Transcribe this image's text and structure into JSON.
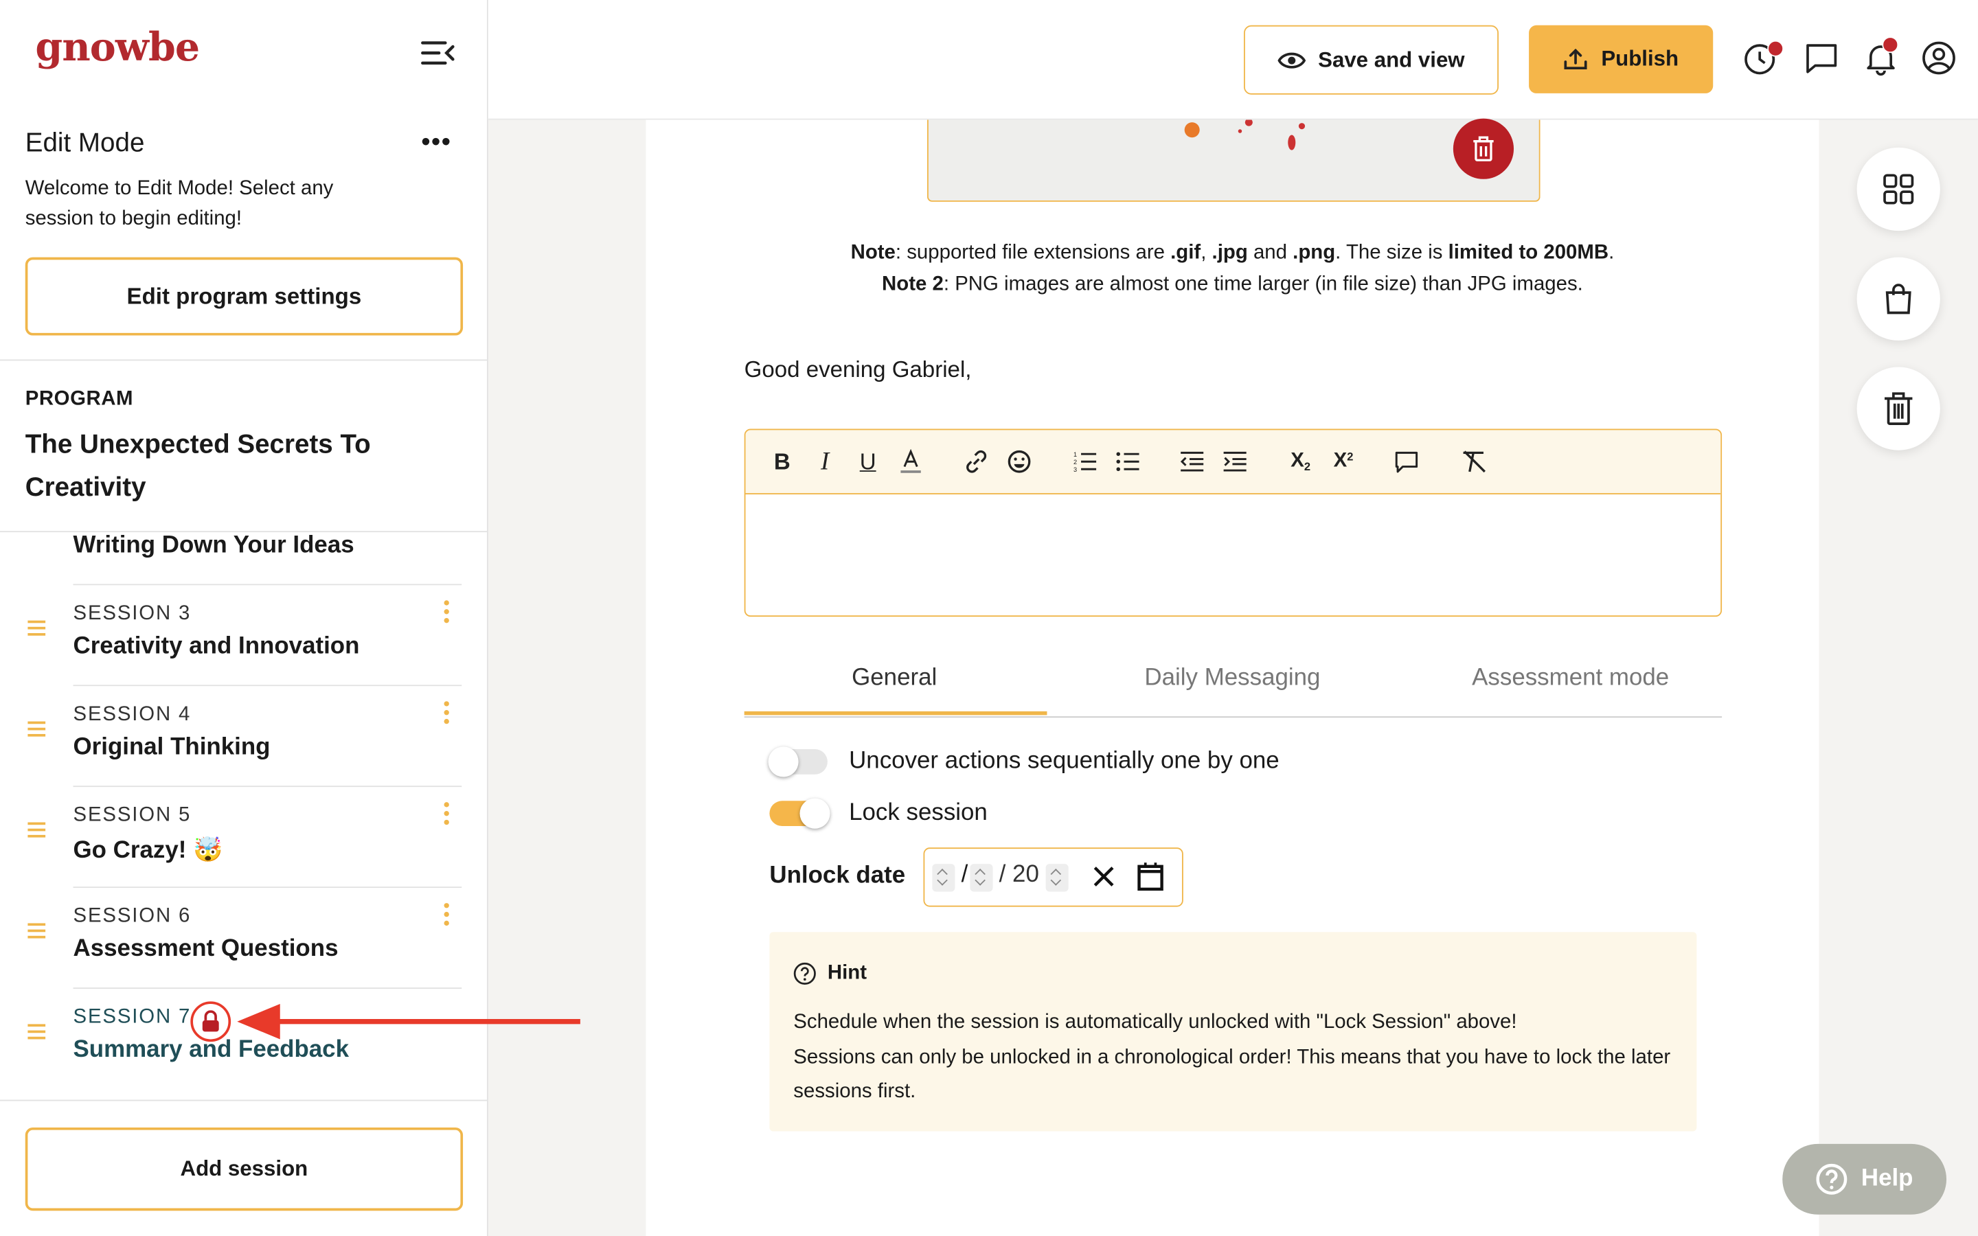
{
  "brand": {
    "logo": "gnowbe",
    "accent": "#f0b64a",
    "primary_button": "#f5b64a",
    "danger": "#b81f25",
    "annotation": "#e83a2a"
  },
  "sidebar": {
    "title": "Edit Mode",
    "welcome": "Welcome to Edit Mode! Select any session to begin editing!",
    "edit_settings_label": "Edit program settings",
    "program_label": "PROGRAM",
    "program_title": "The Unexpected Secrets To Creativity",
    "partial_session_name": "Writing Down Your Ideas",
    "sessions": [
      {
        "number": "SESSION 3",
        "name": "Creativity and Innovation"
      },
      {
        "number": "SESSION 4",
        "name": "Original Thinking"
      },
      {
        "number": "SESSION 5",
        "name": "Go Crazy! 🤯"
      },
      {
        "number": "SESSION 6",
        "name": "Assessment Questions"
      },
      {
        "number": "SESSION 7",
        "name": "Summary and Feedback",
        "selected_color": "#1f4e57",
        "locked": true
      }
    ],
    "add_session_label": "Add session"
  },
  "topbar": {
    "save_view_label": "Save and view",
    "publish_label": "Publish",
    "icons": [
      "history-icon",
      "chat-icon",
      "bell-icon",
      "profile-icon"
    ]
  },
  "content": {
    "note1_label": "Note",
    "note1_text1": ": supported file extensions are ",
    "ext_gif": ".gif",
    "comma": ", ",
    "ext_jpg": ".jpg",
    "and": " and ",
    "ext_png": ".png",
    "note1_text2": ". The size is ",
    "size_limit": "limited to 200MB",
    "period": ".",
    "note2_label": "Note 2",
    "note2_text": ": PNG images are almost one time larger (in file size) than JPG images.",
    "greeting": "Good evening Gabriel,",
    "tabs": [
      "General",
      "Daily Messaging",
      "Assessment mode"
    ],
    "toggle_uncover_label": "Uncover actions sequentially one by one",
    "toggle_uncover_on": false,
    "toggle_lock_label": "Lock session",
    "toggle_lock_on": true,
    "unlock_label": "Unlock date",
    "date_sep1": "/",
    "date_sep2": "/ 20",
    "hint_title": "Hint",
    "hint_line1": "Schedule when the session is automatically unlocked with \"Lock Session\" above!",
    "hint_line2": "Sessions can only be unlocked in a chronological order! This means that you have to lock the later sessions first."
  },
  "help_label": "Help"
}
